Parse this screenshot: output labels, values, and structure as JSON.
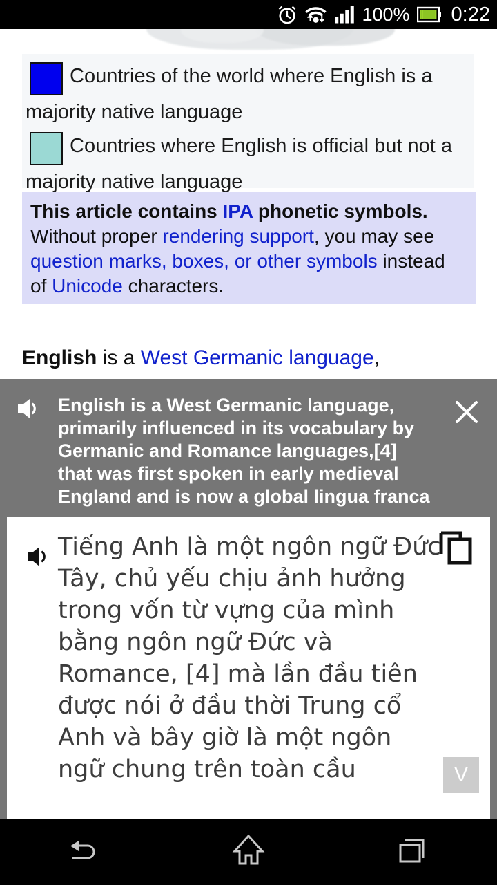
{
  "status_bar": {
    "alarm_icon": "alarm-clock-icon",
    "wifi_icon": "wifi-transfer-icon",
    "signal_icon": "cellular-signal-icon",
    "battery_percent": "100%",
    "battery_icon": "battery-full-icon",
    "battery_color": "#9ad22a",
    "clock": "0:22"
  },
  "article": {
    "legend": {
      "items": [
        {
          "color": "#0000ee",
          "line1": "Countries of the world where English is a",
          "line2": "majority native language"
        },
        {
          "color": "#9bd9d4",
          "line1": "Countries where English is official but not a",
          "line2": "majority native language"
        }
      ]
    },
    "ipa_notice": {
      "background": "#dcdcf8",
      "line1_a": "This article contains ",
      "line1_link": "IPA",
      "line1_b": " phonetic symbols.",
      "line2_a": "Without proper ",
      "line2_link": "rendering support",
      "line2_b": ", you may see",
      "line3_link": "question marks, boxes, or other symbols",
      "line3_b": " instead",
      "line4_a": "of ",
      "line4_link": "Unicode",
      "line4_b": " characters.",
      "link_color": "#1122cc"
    },
    "lead": {
      "bold": "English",
      "mid": " is a ",
      "link": "West Germanic language",
      "tail": ","
    }
  },
  "translate_overlay": {
    "background": "#767676",
    "speaker_icon": "speaker-icon",
    "close_icon": "close-icon",
    "source_text": "English is a West Germanic language, primarily influenced in its vocabulary by Germanic and Romance languages,[4] that was first spoken in early medieval England and is now a global lingua franca",
    "card": {
      "speaker_icon": "speaker-icon",
      "copy_icon": "copy-icon",
      "translated_text": "Tiếng Anh là một ngôn ngữ Đức Tây, chủ yếu chịu ảnh hưởng trong vốn từ vựng của mình bằng ngôn ngữ Đức và Romance, [4] mà lần đầu tiên được nói ở đầu thời Trung cổ Anh và bây giờ là một ngôn ngữ chung trên toàn cầu",
      "expand_label": "V"
    }
  },
  "nav_bar": {
    "back_icon": "back-arrow-icon",
    "home_icon": "home-icon",
    "recents_icon": "recent-apps-icon"
  }
}
